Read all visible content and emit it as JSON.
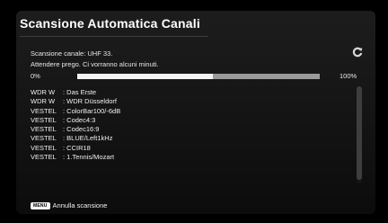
{
  "dialog": {
    "title": "Scansione Automatica Canali",
    "scan_channel": "Scansione canale: UHF 33.",
    "wait_message": "Attendere prego. Ci vorranno alcuni minuti.",
    "progress_min_label": "0%",
    "progress_max_label": "100%",
    "progress_fraction": 0.56
  },
  "channels": [
    {
      "provider": "WDR W",
      "name": ": Das Erste"
    },
    {
      "provider": "WDR W",
      "name": ": WDR Düsseldorf"
    },
    {
      "provider": "VESTEL",
      "name": ": ColorBar100/-6dB"
    },
    {
      "provider": "VESTEL",
      "name": ": Codec4:3"
    },
    {
      "provider": "VESTEL",
      "name": ": Codec16:9"
    },
    {
      "provider": "VESTEL",
      "name": ": BLUE/Left1kHz"
    },
    {
      "provider": "VESTEL",
      "name": ": CCIR18"
    },
    {
      "provider": "VESTEL",
      "name": ": 1.Tennis/Mozart"
    }
  ],
  "footer": {
    "key_label": "MENU",
    "action_label": "Annulla scansione"
  },
  "icons": {
    "refresh": "refresh-icon"
  }
}
